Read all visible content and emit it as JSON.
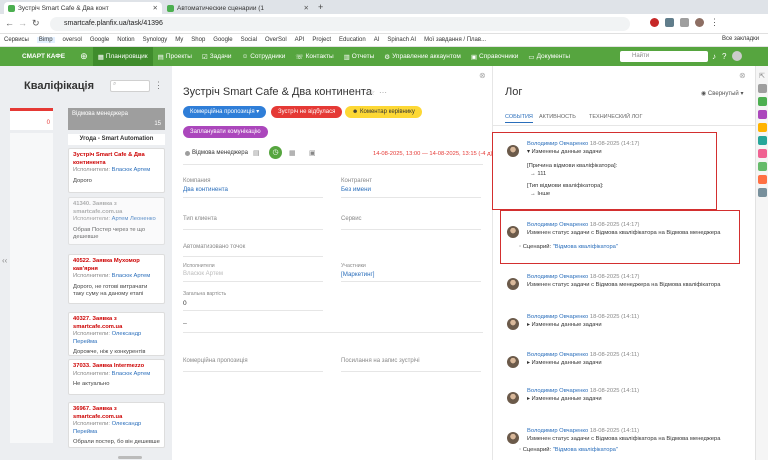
{
  "browser": {
    "tabs": [
      {
        "label": "Зустріч Smart Cafe & Два конт"
      },
      {
        "label": "Автоматические сценарии (1"
      }
    ],
    "url": "smartcafe.planfix.ua/task/41396",
    "bookmarks": [
      "Сервисы",
      "Bimp",
      "oversol",
      "Google",
      "Notion",
      "Synology",
      "My",
      "Shop",
      "Google",
      "Social",
      "OverSol",
      "API",
      "Project",
      "Education",
      "AI",
      "Spinach AI",
      "Мої завдання / Плав..."
    ],
    "all_bookmarks": "Все закладки"
  },
  "appnav": {
    "logo": "СМАРТ КАФЕ",
    "items": [
      "Планировщик",
      "Проекты",
      "Задачи",
      "Сотрудники",
      "Контакты",
      "Отчеты",
      "Управление аккаунтом",
      "Справочники",
      "Документы"
    ],
    "search_placeholder": "Найти"
  },
  "kanban": {
    "title": "Кваліфікація",
    "column_title": "Відмова менеджера",
    "column_count": "15",
    "red_column_count": "0",
    "group_title": "Угода - Smart Automation",
    "cards": [
      {
        "title": "Зустріч Smart Cafe & Два континента",
        "exec_label": "Исполнители:",
        "exec": "Власюк Артем",
        "text": "Дорого"
      },
      {
        "title": "41340. Заявка з smartcafe.com.ua",
        "exec_label": "Исполнители:",
        "exec": "Артем Леоненко",
        "text": "Обрав Постер через те що дешевше",
        "muted": true
      },
      {
        "title": "40522. Заявка Мухомор кав'ярня",
        "exec_label": "Исполнители:",
        "exec": "Власюк Артем",
        "text": "Дорого, не готові витрачати таку суму на даному етапі"
      },
      {
        "title": "40327. Заявка з smartcafe.com.ua",
        "exec_label": "Исполнители:",
        "exec": "Олександр Перейма",
        "text": "Дорожче, ніж у конкурентів"
      },
      {
        "title": "37033. Заявка Intermezzo",
        "exec_label": "Исполнители:",
        "exec": "Власюк Артем",
        "text": "Не актуально"
      },
      {
        "title": "36967. Заявка з smartcafe.com.ua",
        "exec_label": "Исполнители:",
        "exec": "Олександр Перейма",
        "text": "Обрали постер, бо він дешевше"
      }
    ]
  },
  "task": {
    "title": "Зустріч Smart Cafe & Два континента",
    "buttons": [
      "Комерційна пропозиція",
      "Зустріч не відбулася",
      "Коментар керівнику",
      "Запланувати комунікацію"
    ],
    "status": "Відмова менеджера",
    "dates": "14-08-2025, 13:00 — 14-08-2025, 13:15  (-4 д)",
    "fields": {
      "company_label": "Компания",
      "company_value": "Два континента",
      "contragent_label": "Контрагент",
      "contragent_value": "Без имени",
      "client_type_label": "Тип клиента",
      "service_label": "Сервис",
      "auto_points_label": "Автоматизовано точок",
      "executors_label": "Исполнители",
      "executors_value": "Власюк Артем",
      "participants_label": "Участники",
      "participants_value": "[Маркетинг]",
      "total_label": "Загальна вартість",
      "total_value": "0",
      "dash": "–",
      "proposal_label": "Комерційна пропозиція",
      "link_label": "Посилання на запис зустрічі"
    }
  },
  "log": {
    "title": "Лог",
    "collapsed_label": "Свернутый",
    "tabs": [
      "СОБЫТИЯ",
      "АКТИВНОСТЬ",
      "ТЕХНИЧЕСКИЙ ЛОГ"
    ],
    "items": [
      {
        "author": "Володимир Овчаренко",
        "date": "18-08-2025 (14:17)",
        "lines": [
          "▾ Изменены данные задачи"
        ],
        "details": [
          "[Причина відмови кваліфікатора]:",
          "→ 111",
          "[Тип відмови кваліфікатора]:",
          "→ Інше"
        ]
      },
      {
        "author": "Володимир Овчаренко",
        "date": "18-08-2025 (14:17)",
        "lines": [
          "Изменен статус задачи  с Відмова кваліфікатора на Відмова менеджера"
        ],
        "scenario_label": "Сценарий:",
        "scenario": "\"Відмова кваліфікатора\""
      },
      {
        "author": "Володимир Овчаренко",
        "date": "18-08-2025 (14:17)",
        "lines": [
          "Изменен статус задачи  с Відмова менеджера на Відмова кваліфікатора"
        ]
      },
      {
        "author": "Володимир Овчаренко",
        "date": "18-08-2025 (14:11)",
        "lines": [
          "▸ Изменены данные задачи"
        ]
      },
      {
        "author": "Володимир Овчаренко",
        "date": "18-08-2025 (14:11)",
        "lines": [
          "▸ Изменены данные задачи"
        ]
      },
      {
        "author": "Володимир Овчаренко",
        "date": "18-08-2025 (14:11)",
        "lines": [
          "▸ Изменены данные задачи"
        ]
      },
      {
        "author": "Володимир Овчаренко",
        "date": "18-08-2025 (14:11)",
        "lines": [
          "Изменен статус задачи  с Відмова кваліфікатора на Відмова менеджера"
        ],
        "scenario_label": "Сценарий:",
        "scenario": "\"Відмова кваліфікатора\""
      }
    ]
  },
  "colors": {
    "nav_green": "#56a53f",
    "accent_blue": "#2a6ebb",
    "highlight_red": "#d32f2f"
  }
}
